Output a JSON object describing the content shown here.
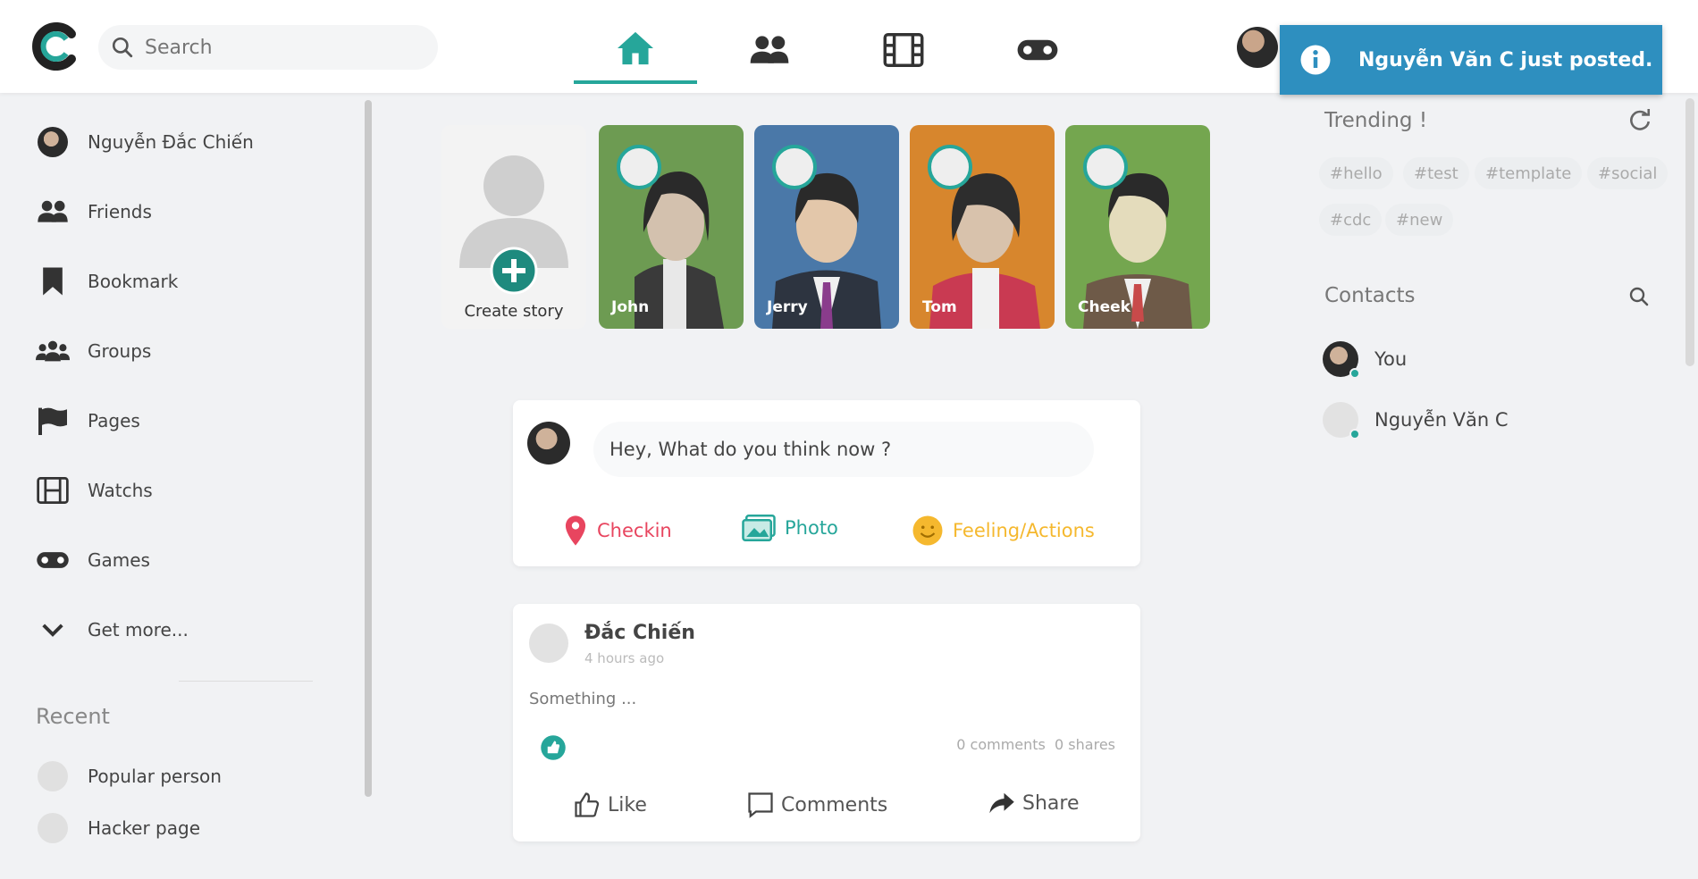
{
  "brand": {
    "accent": "#26a69a",
    "toast_bg": "#2e8fbf"
  },
  "header": {
    "search_placeholder": "Search",
    "tabs": [
      {
        "name": "home",
        "icon": "home-icon",
        "active": true
      },
      {
        "name": "friends",
        "icon": "friends-icon",
        "active": false
      },
      {
        "name": "watch",
        "icon": "film-icon",
        "active": false
      },
      {
        "name": "games",
        "icon": "gamepad-icon",
        "active": false
      }
    ]
  },
  "toast": {
    "message": "Nguyễn Văn C just posted."
  },
  "sidebar": {
    "items": [
      {
        "label": "Nguyễn Đắc Chiến",
        "icon": "avatar"
      },
      {
        "label": "Friends",
        "icon": "friends-icon"
      },
      {
        "label": "Bookmark",
        "icon": "bookmark-icon"
      },
      {
        "label": "Groups",
        "icon": "groups-icon"
      },
      {
        "label": "Pages",
        "icon": "flag-icon"
      },
      {
        "label": "Watchs",
        "icon": "film-icon"
      },
      {
        "label": "Games",
        "icon": "gamepad-icon"
      },
      {
        "label": "Get more...",
        "icon": "chevron-down-icon"
      }
    ],
    "recent_heading": "Recent",
    "recent": [
      {
        "label": "Popular person"
      },
      {
        "label": "Hacker page"
      }
    ]
  },
  "stories": {
    "create_label": "Create story",
    "items": [
      {
        "name": "John",
        "bg": "#6d9b52"
      },
      {
        "name": "Jerry",
        "bg": "#4a78a8"
      },
      {
        "name": "Tom",
        "bg": "#d7862d"
      },
      {
        "name": "Cheek",
        "bg": "#74a64f"
      }
    ]
  },
  "composer": {
    "placeholder": "Hey, What do you think now ?",
    "actions": [
      {
        "label": "Checkin",
        "color": "#e8455f",
        "icon": "location-pin-icon"
      },
      {
        "label": "Photo",
        "color": "#26a69a",
        "icon": "photo-icon"
      },
      {
        "label": "Feeling/Actions",
        "color": "#f5b82e",
        "icon": "smile-icon"
      }
    ]
  },
  "post": {
    "author": "Đắc Chiến",
    "time": "4 hours ago",
    "content": "Something ...",
    "stats": "0 comments  0 shares",
    "like_label": "Like",
    "comments_label": "Comments",
    "share_label": "Share"
  },
  "right": {
    "trending_title": "Trending !",
    "tags": [
      "#hello",
      "#test",
      "#template",
      "#social",
      "#cdc",
      "#new"
    ],
    "contacts_title": "Contacts",
    "contacts": [
      {
        "name": "You"
      },
      {
        "name": "Nguyễn Văn C"
      }
    ]
  }
}
